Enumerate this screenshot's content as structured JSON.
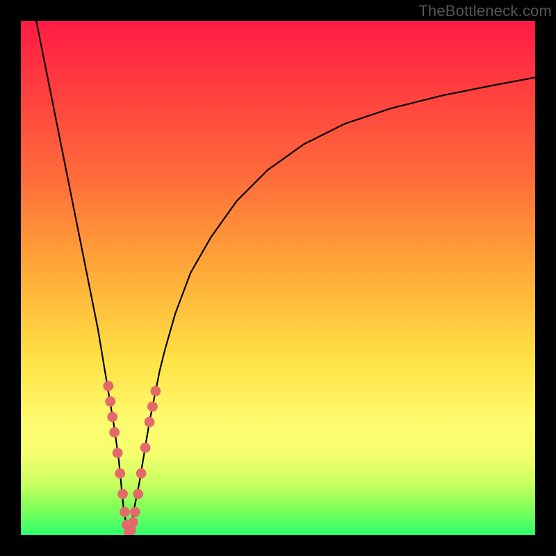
{
  "watermark": "TheBottleneck.com",
  "colors": {
    "frame": "#000000",
    "curve": "#000000",
    "marker": "#e46a6a",
    "gradient_stops": [
      "#ff1a44",
      "#ff3b3f",
      "#ff6a3a",
      "#ffa838",
      "#ffe244",
      "#fffb70",
      "#f6ff6e",
      "#c8ff5e",
      "#7dff58",
      "#2fff70"
    ]
  },
  "chart_data": {
    "type": "line",
    "title": "",
    "xlabel": "",
    "ylabel": "",
    "xlim": [
      0,
      100
    ],
    "ylim": [
      0,
      100
    ],
    "legend": false,
    "grid": false,
    "series": [
      {
        "name": "bottleneck-curve",
        "x": [
          3,
          5,
          7,
          9,
          11,
          13,
          15,
          16,
          17,
          18,
          19,
          19.5,
          20,
          20.5,
          21,
          21.5,
          22,
          23,
          24,
          25,
          26,
          27,
          28,
          30,
          33,
          37,
          42,
          48,
          55,
          63,
          72,
          82,
          92,
          100
        ],
        "y": [
          100,
          90,
          80,
          70,
          60,
          50,
          40,
          34,
          28,
          22,
          15,
          10,
          5,
          2,
          0,
          2,
          5,
          10,
          16,
          22,
          27,
          32,
          36,
          43,
          51,
          58,
          65,
          71,
          76,
          80,
          83,
          85.5,
          87.5,
          89
        ]
      }
    ],
    "markers": [
      {
        "x": 17.0,
        "y": 29
      },
      {
        "x": 17.4,
        "y": 26
      },
      {
        "x": 17.8,
        "y": 23
      },
      {
        "x": 18.2,
        "y": 20
      },
      {
        "x": 18.8,
        "y": 16
      },
      {
        "x": 19.3,
        "y": 12
      },
      {
        "x": 19.8,
        "y": 8
      },
      {
        "x": 20.2,
        "y": 4.5
      },
      {
        "x": 20.6,
        "y": 2
      },
      {
        "x": 21.0,
        "y": 0.5
      },
      {
        "x": 21.4,
        "y": 1
      },
      {
        "x": 21.8,
        "y": 2.5
      },
      {
        "x": 22.2,
        "y": 4.5
      },
      {
        "x": 22.8,
        "y": 8
      },
      {
        "x": 23.4,
        "y": 12
      },
      {
        "x": 24.2,
        "y": 17
      },
      {
        "x": 25.0,
        "y": 22
      },
      {
        "x": 25.6,
        "y": 25
      },
      {
        "x": 26.2,
        "y": 28
      }
    ],
    "marker_radius_logical": 1.0
  }
}
